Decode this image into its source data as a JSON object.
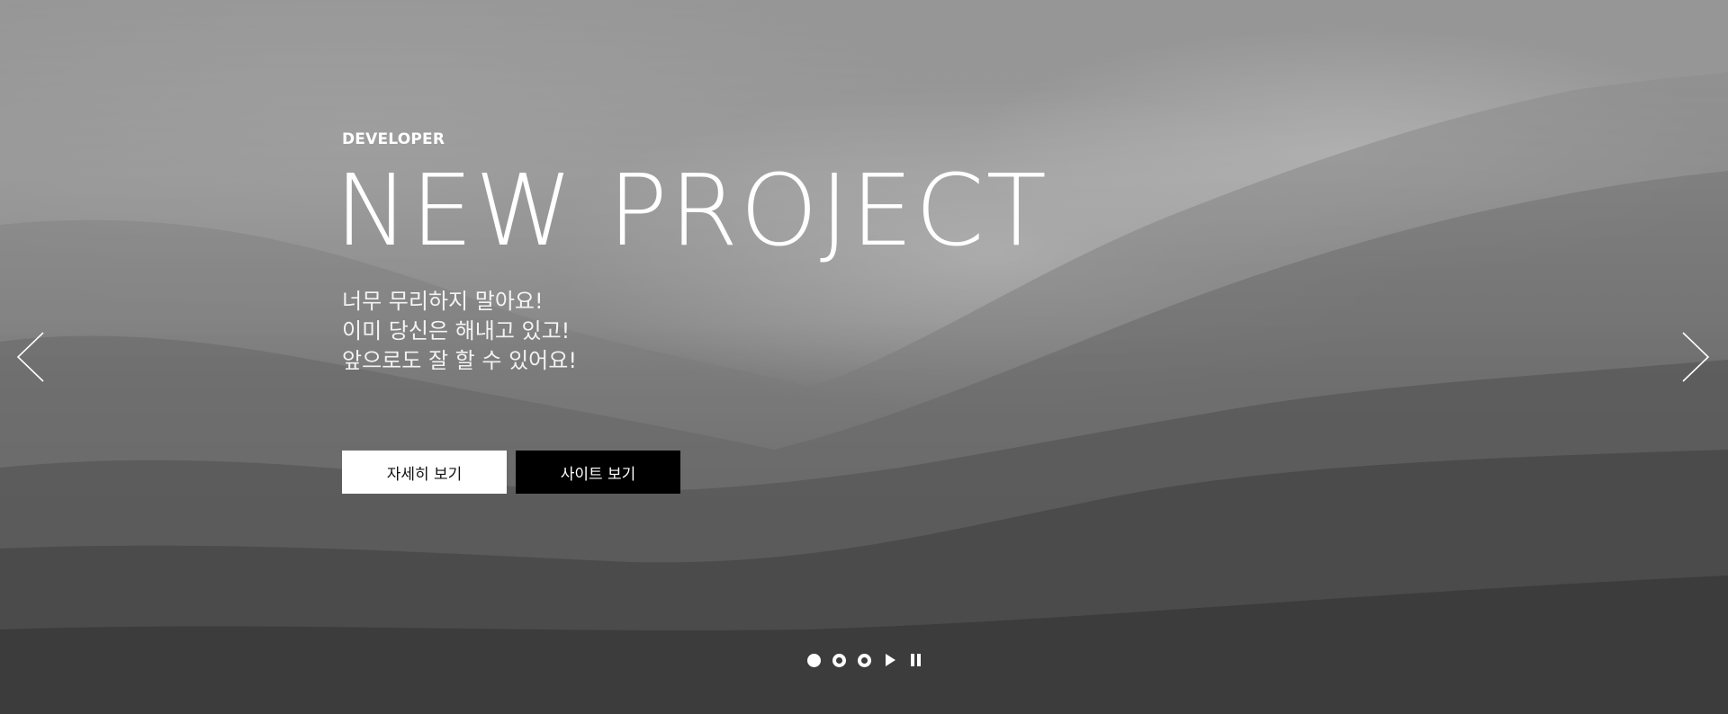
{
  "hero": {
    "eyebrow": "DEVELOPER",
    "headline": "NEW PROJECT",
    "copy_lines": [
      "너무 무리하지 말아요!",
      "이미 당신은 해내고 있고!",
      "앞으로도 잘 할 수 있어요!"
    ],
    "buttons": {
      "details_label": "자세히 보기",
      "site_label": "사이트 보기"
    }
  },
  "slider": {
    "prev_icon": "chevron-left-icon",
    "next_icon": "chevron-right-icon",
    "pagination": {
      "count": 3,
      "active_index": 0
    },
    "play_icon": "play-icon",
    "pause_icon": "pause-icon"
  },
  "colors": {
    "text": "#ffffff",
    "button_light_bg": "#ffffff",
    "button_dark_bg": "#000000"
  }
}
